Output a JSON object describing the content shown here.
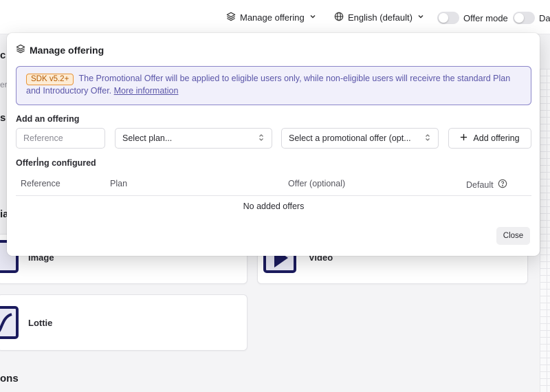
{
  "topbar": {
    "manage_offering": "Manage offering",
    "language": "English (default)",
    "offer_mode": "Offer mode",
    "truncated_toggle": "Da"
  },
  "background": {
    "heading_1": "c",
    "heading_2": "s",
    "input_fragment": "er",
    "section_2": "ia",
    "card_image": "Image",
    "card_video": "Video",
    "card_lottie": "Lottie",
    "section_3": "ons"
  },
  "modal": {
    "title": "Manage offering",
    "notice": {
      "badge": "SDK v5.2+",
      "text": "The Promotional Offer will be applied to eligible users only, while non-eligible users will receivre the standard Plan and Introductory Offer.",
      "link": "More information"
    },
    "add_section_label": "Add an offering",
    "reference_placeholder": "Reference",
    "plan_select": "Select plan...",
    "promo_select": "Select a promotional offer (opt...",
    "add_button": "Add offering",
    "configured_label": "Offering configured",
    "columns": [
      "Reference",
      "Plan",
      "Offer (optional)",
      "Default"
    ],
    "empty_text": "No added offers",
    "close_button": "Close"
  },
  "colors": {
    "accent": "#5a55a8",
    "badge_bg": "#fdebd3",
    "badge_text": "#b55a00",
    "thumb_border": "#1b1b5e"
  },
  "icons": [
    "layers-icon",
    "globe-icon",
    "chevron-down-icon",
    "chevron-updown-icon",
    "plus-icon",
    "help-circle-icon",
    "text-cursor-icon"
  ]
}
